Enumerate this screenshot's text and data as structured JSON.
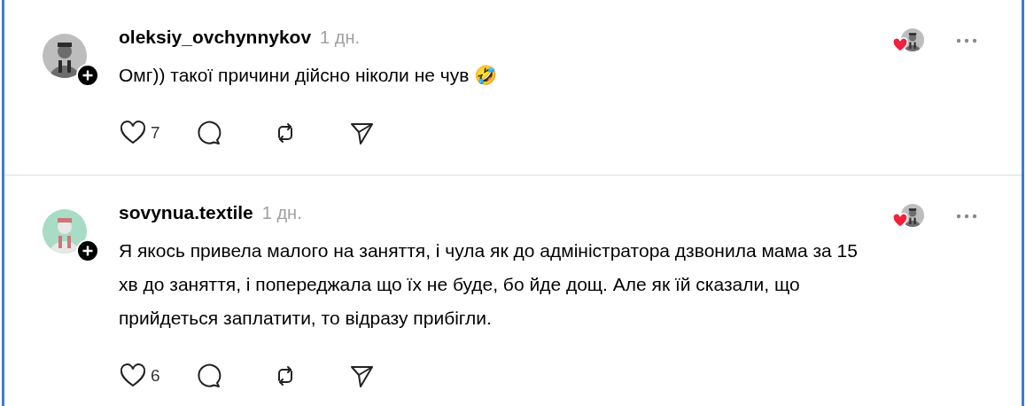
{
  "posts": [
    {
      "username": "oleksiy_ovchynnykov",
      "time": "1 дн.",
      "text": "Омг)) такої причини дійсно ніколи не чув 🤣",
      "likes": "7"
    },
    {
      "username": "sovynua.textile",
      "time": "1 дн.",
      "text": "Я якось привела малого на заняття, і чула як до адміністратора дзвонила мама за 15 хв до заняття, і попереджала що їх не буде, бо йде дощ. Але як їй сказали, що прийдеться заплатити, то відразу прибігли.",
      "likes": "6"
    }
  ]
}
